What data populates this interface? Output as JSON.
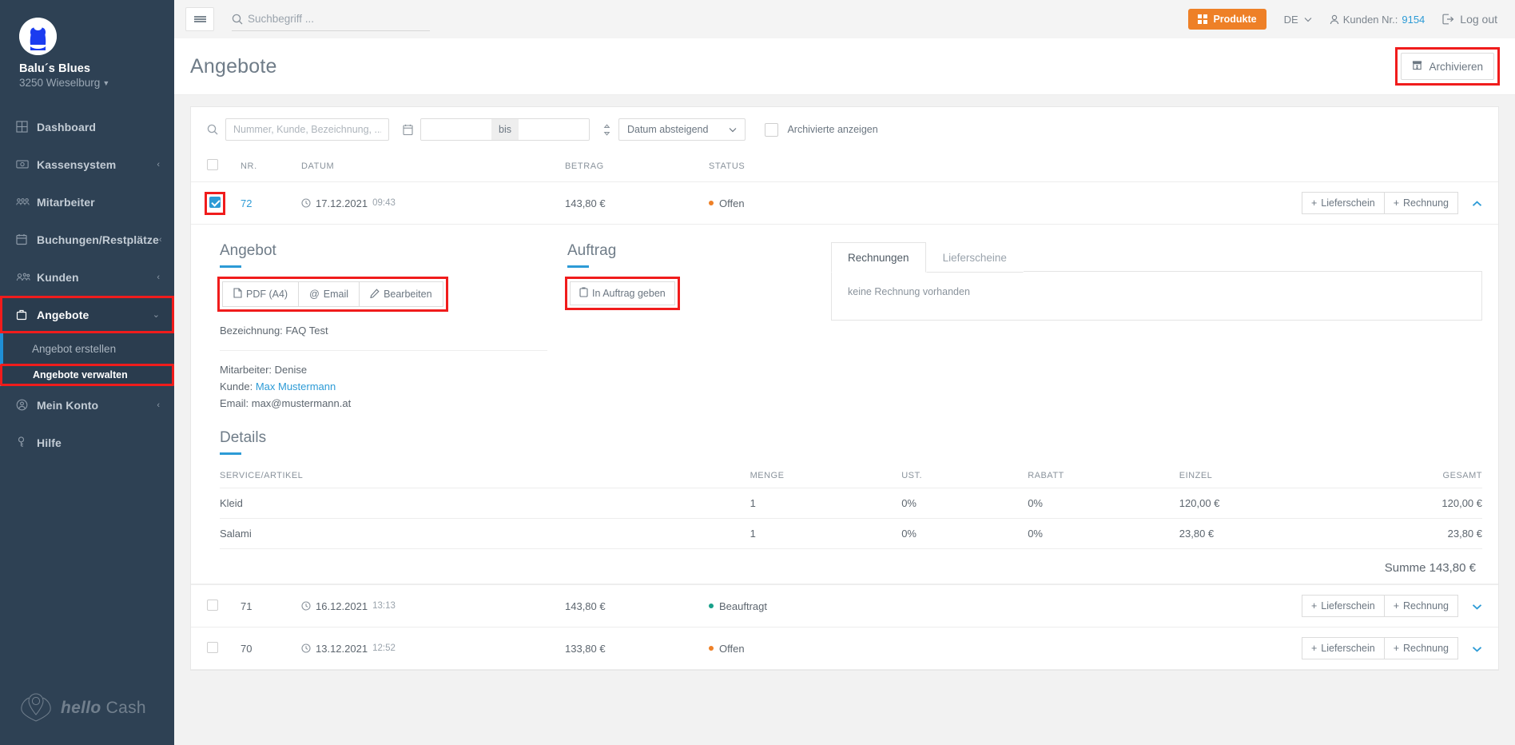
{
  "sidebar": {
    "brand_name": "Balu´s Blues",
    "brand_location": "3250 Wieselburg",
    "items": [
      {
        "label": "Dashboard",
        "icon": "grid-icon",
        "chevron": ""
      },
      {
        "label": "Kassensystem",
        "icon": "cash-icon",
        "chevron": "‹"
      },
      {
        "label": "Mitarbeiter",
        "icon": "employees-icon",
        "chevron": ""
      },
      {
        "label": "Buchungen/Restplätze",
        "icon": "calendar-icon",
        "chevron": "‹"
      },
      {
        "label": "Kunden",
        "icon": "customers-icon",
        "chevron": "‹"
      },
      {
        "label": "Angebote",
        "icon": "briefcase-icon",
        "chevron": "⌄"
      },
      {
        "label": "Mein Konto",
        "icon": "account-icon",
        "chevron": "‹"
      },
      {
        "label": "Hilfe",
        "icon": "help-icon",
        "chevron": ""
      }
    ],
    "subitems": [
      {
        "label": "Angebot erstellen"
      },
      {
        "label": "Angebote verwalten"
      }
    ],
    "logo_text_a": "hello",
    "logo_text_b": "Cash"
  },
  "topbar": {
    "search_placeholder": "Suchbegriff ...",
    "search_value": "",
    "produkte_label": "Produkte",
    "language": "DE",
    "kunden_label": "Kunden Nr.:",
    "kunden_nr": "9154",
    "logout_label": "Log out"
  },
  "page": {
    "title": "Angebote",
    "archive_label": "Archivieren"
  },
  "filters": {
    "search_placeholder": "Nummer, Kunde, Bezeichnung, ...",
    "search_value": "",
    "date_from": "",
    "date_to": "",
    "bis_label": "bis",
    "sort_value": "Datum absteigend",
    "archived_label": "Archivierte anzeigen"
  },
  "table": {
    "headers": {
      "nr": "NR.",
      "datum": "DATUM",
      "betrag": "BETRAG",
      "status": "STATUS"
    },
    "action_lieferschein": "Lieferschein",
    "action_rechnung": "Rechnung",
    "rows": [
      {
        "nr": "72",
        "date": "17.12.2021",
        "time": "09:43",
        "amount": "143,80 €",
        "status": "Offen",
        "status_color": "#ee8027",
        "checked": true,
        "expanded": true
      },
      {
        "nr": "71",
        "date": "16.12.2021",
        "time": "13:13",
        "amount": "143,80 €",
        "status": "Beauftragt",
        "status_color": "#18a08a",
        "checked": false,
        "expanded": false
      },
      {
        "nr": "70",
        "date": "13.12.2021",
        "time": "12:52",
        "amount": "133,80 €",
        "status": "Offen",
        "status_color": "#ee8027",
        "checked": false,
        "expanded": false
      }
    ]
  },
  "expanded": {
    "angebot": {
      "title": "Angebot",
      "btn_pdf": "PDF (A4)",
      "btn_email": "Email",
      "btn_edit": "Bearbeiten",
      "bezeichnung_label": "Bezeichnung:",
      "bezeichnung_value": "FAQ Test",
      "mitarbeiter_label": "Mitarbeiter:",
      "mitarbeiter_value": "Denise",
      "kunde_label": "Kunde:",
      "kunde_value": "Max Mustermann",
      "email_label": "Email:",
      "email_value": "max@mustermann.at"
    },
    "auftrag": {
      "title": "Auftrag",
      "btn_order": "In Auftrag geben"
    },
    "docs": {
      "tab_rechnungen": "Rechnungen",
      "tab_lieferscheine": "Lieferscheine",
      "empty_text": "keine Rechnung vorhanden"
    },
    "details": {
      "title": "Details",
      "headers": {
        "artikel": "SERVICE/ARTIKEL",
        "menge": "MENGE",
        "ust": "UST.",
        "rabatt": "RABATT",
        "einzel": "EINZEL",
        "gesamt": "GESAMT"
      },
      "rows": [
        {
          "artikel": "Kleid",
          "menge": "1",
          "ust": "0%",
          "rabatt": "0%",
          "einzel": "120,00 €",
          "gesamt": "120,00 €"
        },
        {
          "artikel": "Salami",
          "menge": "1",
          "ust": "0%",
          "rabatt": "0%",
          "einzel": "23,80 €",
          "gesamt": "23,80 €"
        }
      ],
      "sum_label": "Summe 143,80 €"
    }
  },
  "colors": {
    "sidebar_bg": "#2e4154",
    "accent_blue": "#2d9bd6",
    "orange": "#ee8027",
    "highlight_red": "#f01c1c",
    "green": "#18a08a"
  }
}
